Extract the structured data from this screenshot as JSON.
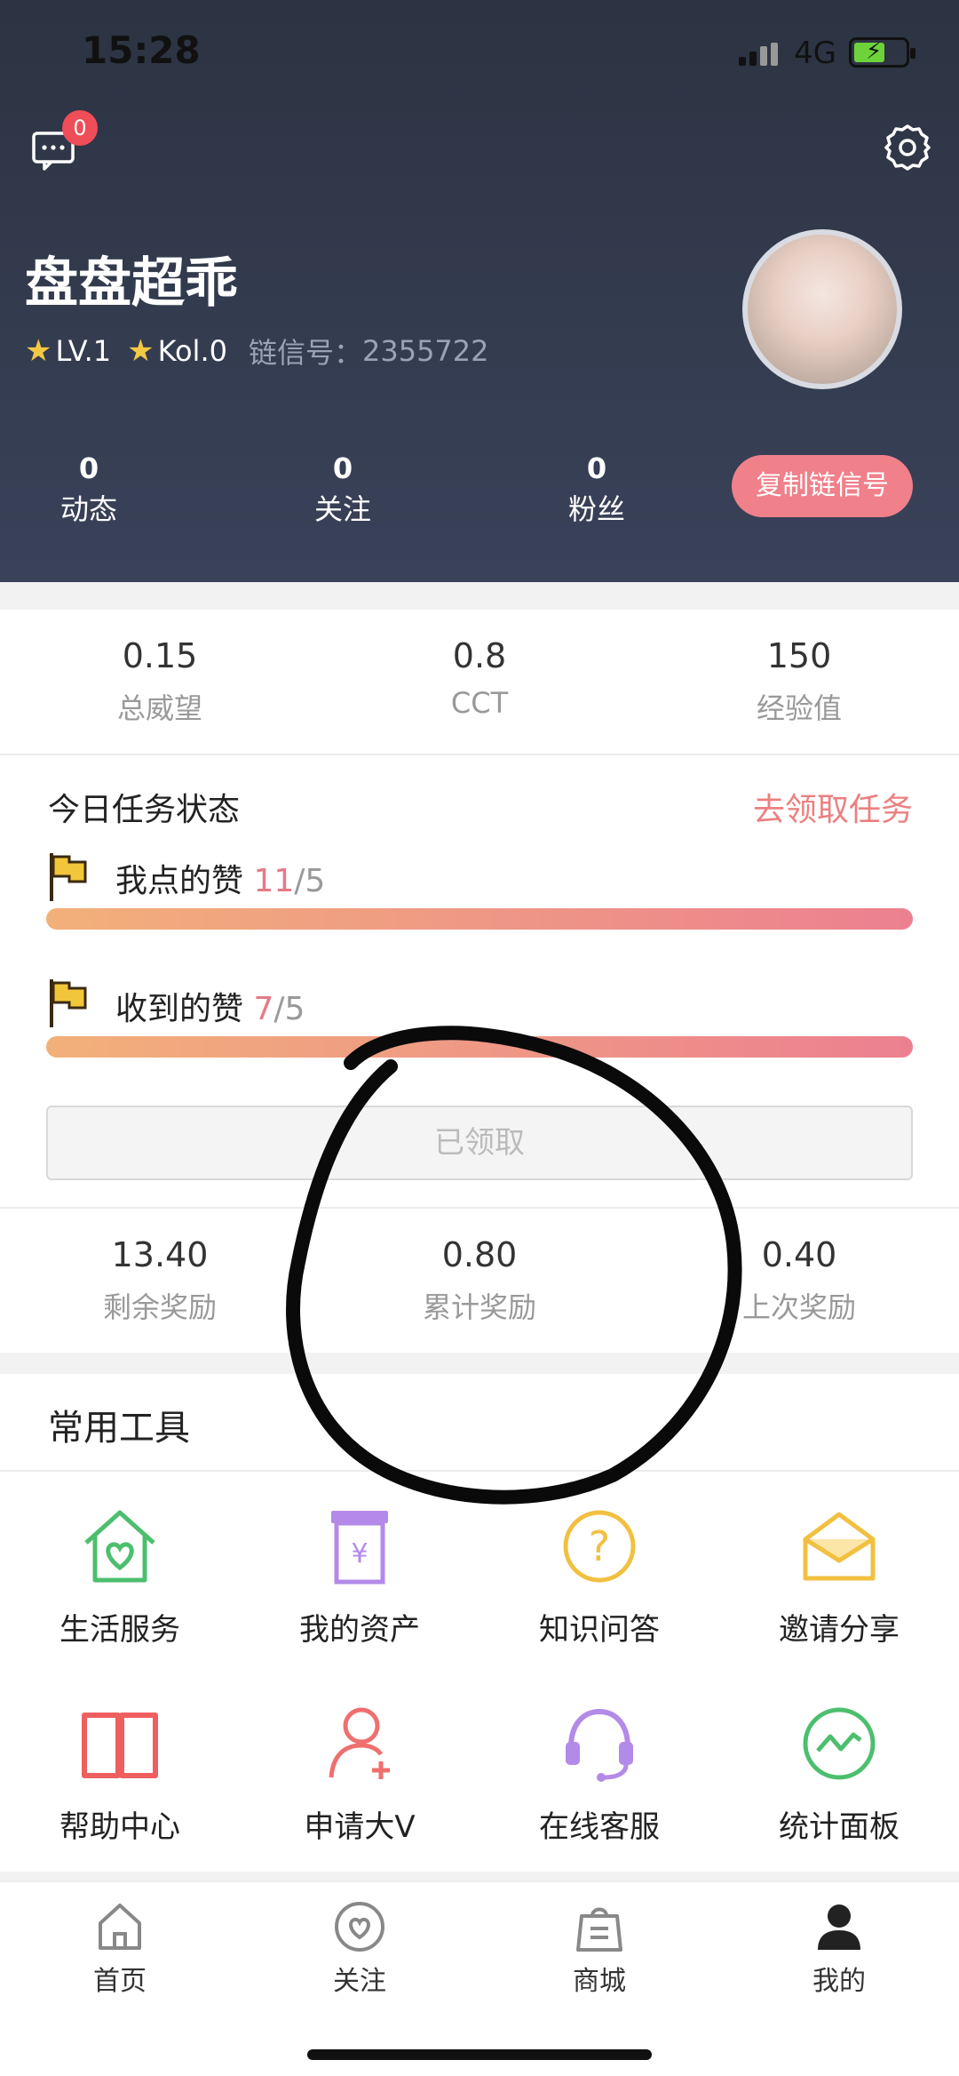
{
  "status_bar": {
    "time": "15:28",
    "network": "4G"
  },
  "header": {
    "message_badge": "0",
    "username": "盘盘超乖",
    "level": "LV.1",
    "kol": "Kol.0",
    "chain_label": "链信号：",
    "chain_id": "2355722",
    "stats": [
      {
        "value": "0",
        "label": "动态"
      },
      {
        "value": "0",
        "label": "关注"
      },
      {
        "value": "0",
        "label": "粉丝"
      }
    ],
    "copy_button": "复制链信号"
  },
  "metrics": [
    {
      "value": "0.15",
      "label": "总威望"
    },
    {
      "value": "0.8",
      "label": "CCT"
    },
    {
      "value": "150",
      "label": "经验值"
    }
  ],
  "tasks": {
    "title": "今日任务状态",
    "link": "去领取任务",
    "items": [
      {
        "label": "我点的赞",
        "current": "11",
        "total": "/5",
        "progress": 1.0
      },
      {
        "label": "收到的赞",
        "current": "7",
        "total": "/5",
        "progress": 1.0
      }
    ],
    "claimed_button": "已领取"
  },
  "rewards": [
    {
      "value": "13.40",
      "label": "剩余奖励"
    },
    {
      "value": "0.80",
      "label": "累计奖励"
    },
    {
      "value": "0.40",
      "label": "上次奖励"
    }
  ],
  "tools": {
    "title": "常用工具",
    "items": [
      {
        "label": "生活服务",
        "icon": "home-heart-icon",
        "color": "#4cbf6e"
      },
      {
        "label": "我的资产",
        "icon": "asset-receipt-icon",
        "color": "#b48ae8"
      },
      {
        "label": "知识问答",
        "icon": "question-circle-icon",
        "color": "#f2c040"
      },
      {
        "label": "邀请分享",
        "icon": "envelope-icon",
        "color": "#f2c040"
      },
      {
        "label": "帮助中心",
        "icon": "book-icon",
        "color": "#ef5f5f"
      },
      {
        "label": "申请大V",
        "icon": "add-user-icon",
        "color": "#ef6f6f"
      },
      {
        "label": "在线客服",
        "icon": "headset-icon",
        "color": "#b48ae8"
      },
      {
        "label": "统计面板",
        "icon": "trend-chart-icon",
        "color": "#4cbf6e"
      }
    ]
  },
  "tabbar": [
    {
      "label": "首页",
      "icon": "home-icon"
    },
    {
      "label": "关注",
      "icon": "heart-icon"
    },
    {
      "label": "商城",
      "icon": "shopping-bag-icon"
    },
    {
      "label": "我的",
      "icon": "user-icon"
    }
  ]
}
